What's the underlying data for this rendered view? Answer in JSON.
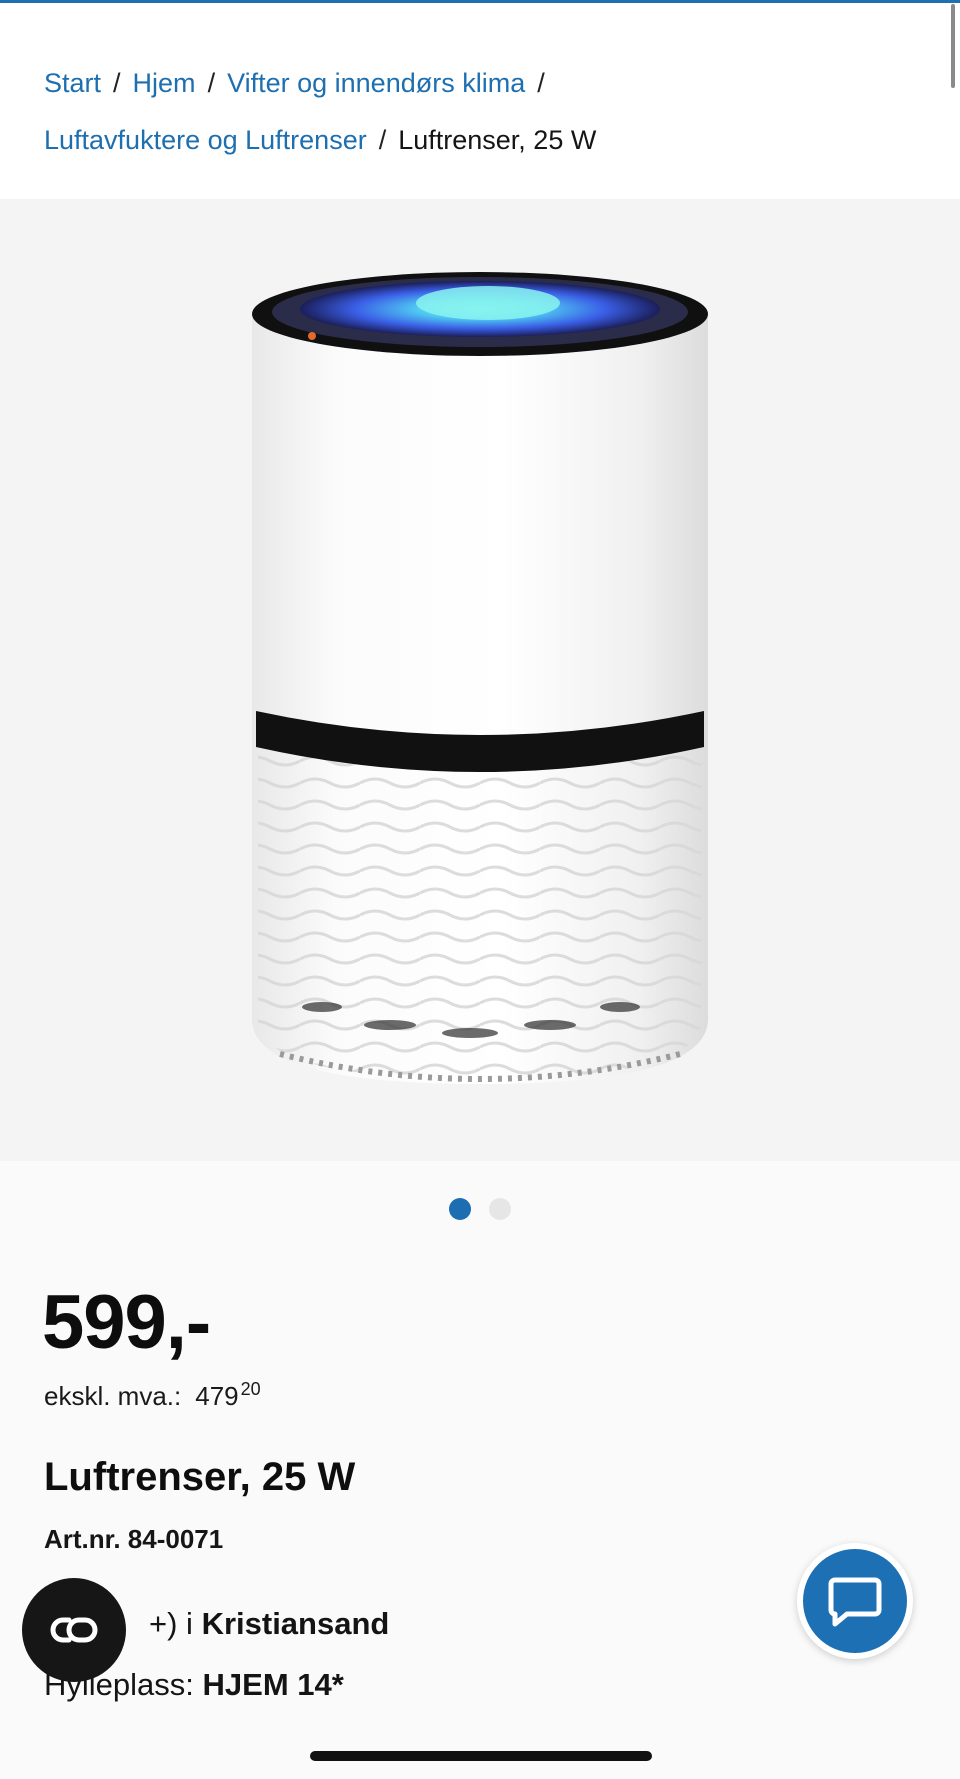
{
  "colors": {
    "link": "#1e6fb0",
    "accent": "#1d70b4",
    "text": "#111111",
    "background": "#fafafa"
  },
  "breadcrumb": {
    "items": [
      {
        "label": "Start",
        "link": true
      },
      {
        "label": "Hjem",
        "link": true
      },
      {
        "label": "Vifter og innendørs klima",
        "link": true
      },
      {
        "label": "Luftavfuktere og Luftrenser",
        "link": true
      },
      {
        "label": "Luftrenser, 25 W",
        "link": false
      }
    ],
    "separator": "/"
  },
  "gallery": {
    "image_count": 2,
    "active_index": 0,
    "image_icon": "air-purifier-product-image"
  },
  "product": {
    "price": "599,-",
    "vat_label": "ekskl. mva.:",
    "vat_kroner": "479",
    "vat_ore": "20",
    "title": "Luftrenser, 25 W",
    "article_number": "Art.nr. 84-0071",
    "stock_prefix": "+) i",
    "stock_store": "Kristiansand",
    "shelf_label": "Hylleplass:",
    "shelf_value": "HJEM 14*"
  },
  "floating_buttons": {
    "cookie_icon": "cookie-consent-icon",
    "chat_icon": "chat-bubble-icon"
  }
}
